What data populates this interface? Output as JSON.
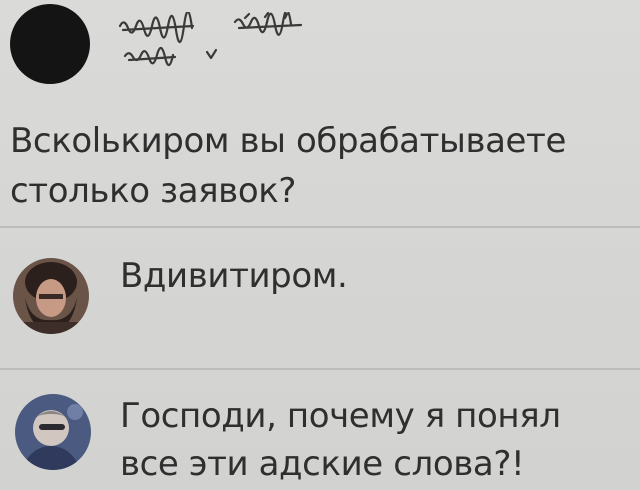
{
  "post": {
    "author_avatar": "black-circle-avatar",
    "author_name_redacted": true,
    "text_line1": "Вскolькиром вы обрабатываете",
    "text_line2": "столько заявок?"
  },
  "comments": [
    {
      "avatar": "user-photo-avatar",
      "text_line1": "Вдивитиром."
    },
    {
      "avatar": "user-photo-avatar",
      "text_line1": "Господи, почему я понял",
      "text_line2": "все эти адские слова?!"
    }
  ],
  "colors": {
    "background": "#d9d9d7",
    "text": "#2f2f2f",
    "divider": "#bcbcba",
    "post_avatar": "#141414"
  }
}
